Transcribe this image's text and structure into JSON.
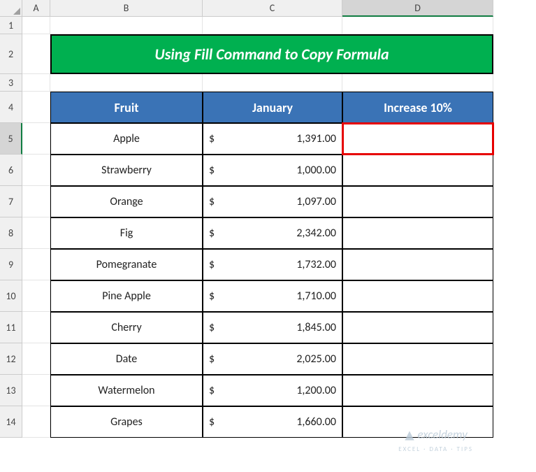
{
  "columns": [
    "A",
    "B",
    "C",
    "D"
  ],
  "rows": [
    "1",
    "2",
    "3",
    "4",
    "5",
    "6",
    "7",
    "8",
    "9",
    "10",
    "11",
    "12",
    "13",
    "14"
  ],
  "selected_col": "D",
  "selected_row": "5",
  "title": "Using Fill Command to Copy Formula",
  "headers": {
    "fruit": "Fruit",
    "january": "January",
    "increase": "Increase 10%"
  },
  "currency_symbol": "$",
  "table": [
    {
      "fruit": "Apple",
      "value": "1,391.00"
    },
    {
      "fruit": "Strawberry",
      "value": "1,000.00"
    },
    {
      "fruit": "Orange",
      "value": "1,097.00"
    },
    {
      "fruit": "Fig",
      "value": "2,342.00"
    },
    {
      "fruit": "Pomegranate",
      "value": "1,732.00"
    },
    {
      "fruit": "Pine Apple",
      "value": "1,710.00"
    },
    {
      "fruit": "Cherry",
      "value": "1,845.00"
    },
    {
      "fruit": "Date",
      "value": "2,025.00"
    },
    {
      "fruit": "Watermelon",
      "value": "1,200.00"
    },
    {
      "fruit": "Grapes",
      "value": "1,660.00"
    }
  ],
  "watermark": {
    "brand": "exceldemy",
    "tagline": "EXCEL · DATA · TIPS"
  }
}
